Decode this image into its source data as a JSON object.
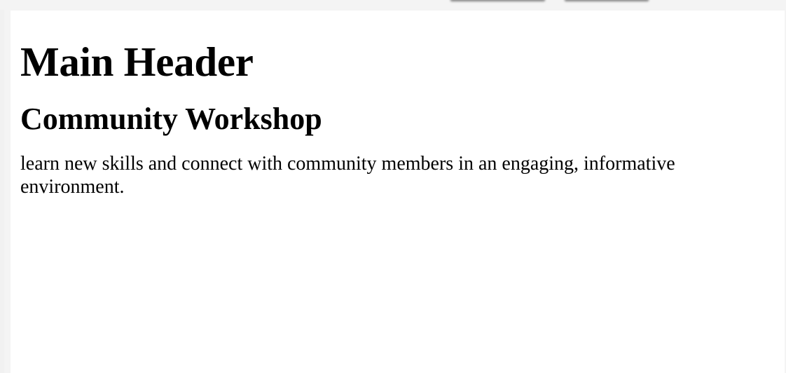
{
  "page": {
    "main_header": "Main Header",
    "sub_header": "Community Workshop",
    "description": "learn new skills and connect with community members in an engaging, informative environment."
  }
}
